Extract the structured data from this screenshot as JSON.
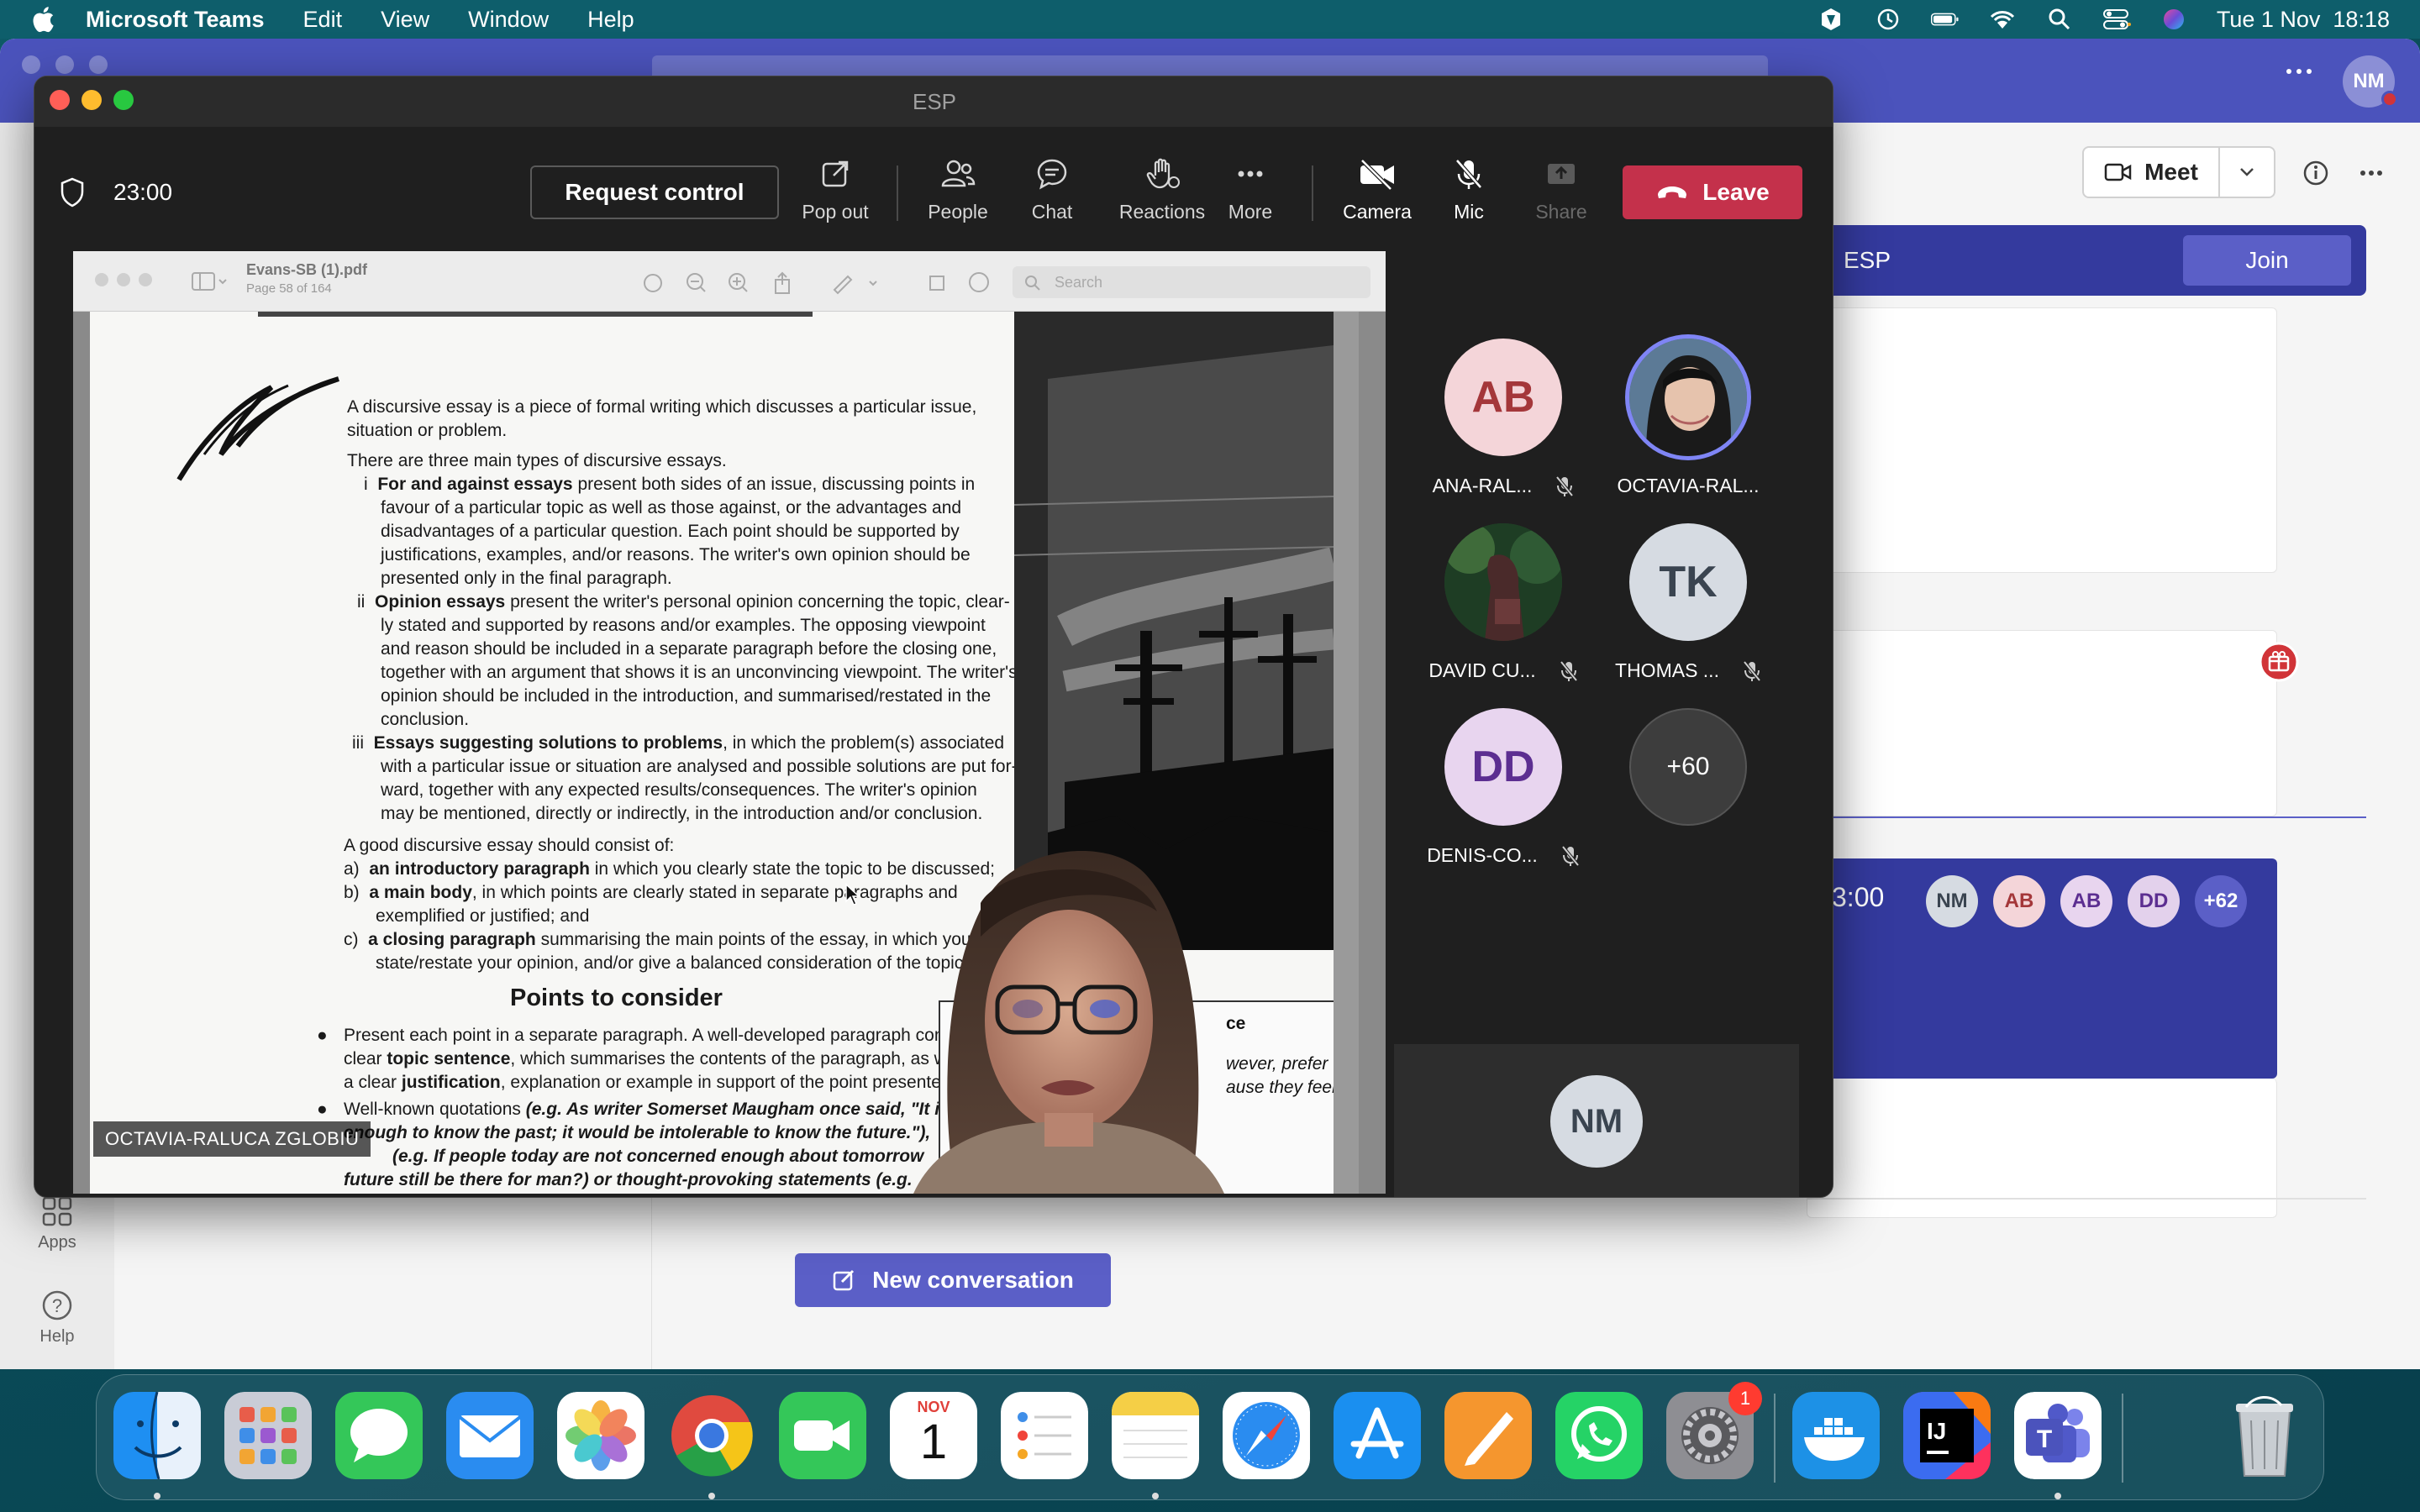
{
  "menubar": {
    "app_name": "Microsoft Teams",
    "menus": [
      "Edit",
      "View",
      "Window",
      "Help"
    ],
    "clock": "Tue 1 Nov  18:18"
  },
  "teams_background": {
    "rail": {
      "apps_label": "Apps",
      "help_label": "Help"
    },
    "header": {
      "avatar_initials": "NM",
      "meet_label": "Meet"
    },
    "channel_banner": {
      "title": "ESP",
      "join_label": "Join"
    },
    "meeting_card": {
      "time_fragment": "3:00",
      "avatars": [
        "NM",
        "AB",
        "AB",
        "DD",
        "+62"
      ]
    },
    "new_conversation_label": "New conversation"
  },
  "meeting_window": {
    "title": "ESP",
    "timer": "23:00",
    "request_control_label": "Request control",
    "toolbar": {
      "pop_out": "Pop out",
      "people": "People",
      "chat": "Chat",
      "reactions": "Reactions",
      "more": "More",
      "camera": "Camera",
      "mic": "Mic",
      "share": "Share",
      "leave": "Leave"
    },
    "shared_screen": {
      "pdf_filename": "Evans-SB (1).pdf",
      "pdf_page": "Page 58 of 164",
      "pdf_search_placeholder": "Search",
      "speaker_name": "OCTAVIA-RALUCA ZGLOBIU",
      "document_lines": {
        "l1": "A discursive essay is a piece of formal writing which discusses a particular issue,",
        "l2": "situation or problem.",
        "l3": "There are three main types of discursive essays.",
        "l4_num": "i",
        "l4_bold": "For and against essays",
        "l4_rest": " present both sides of an issue, discussing points in",
        "l5": "favour of a particular topic as well as those against, or the advantages and",
        "l6": "disadvantages of a particular question. Each point should be supported by",
        "l7": "justifications, examples, and/or reasons. The writer's own opinion should be",
        "l8": "presented only in the final paragraph.",
        "l9_num": "ii",
        "l9_bold": "Opinion essays",
        "l9_rest": " present the writer's personal opinion concerning the topic, clear-",
        "l10": "ly stated and supported by reasons and/or examples. The opposing viewpoint",
        "l11": "and reason should be included in a separate paragraph before the closing one,",
        "l12": "together with an argument that shows it is an unconvincing viewpoint. The writer's",
        "l13": "opinion should be included in the introduction, and summarised/restated in the",
        "l14": "conclusion.",
        "l15_num": "iii",
        "l15_bold": "Essays suggesting solutions to problems",
        "l15_rest": ", in which the problem(s) associated",
        "l16": "with a particular issue or situation are analysed and possible solutions are put for-",
        "l17": "ward, together with any expected results/consequences. The writer's opinion",
        "l18": "may be mentioned, directly or indirectly, in the introduction and/or conclusion.",
        "l19": "A good discursive essay should consist of:",
        "l20_num": "a)",
        "l20_bold": "an introductory paragraph",
        "l20_rest": " in which you clearly state the topic to be discussed;",
        "l21_num": "b)",
        "l21_bold": "a main body",
        "l21_rest": ", in which points are clearly stated in separate paragraphs and",
        "l22": "exemplified or justified; and",
        "l23_num": "c)",
        "l23_bold": "a closing paragraph",
        "l23_rest": " summarising the main points of the essay, in which you",
        "l24": "state/restate your opinion, and/or give a balanced consideration of the topic.",
        "heading": "Points to consider",
        "l25": "Present each point in a separate paragraph. A well-developed paragraph contains a",
        "l26_pre": "clear ",
        "l26_bold": "topic sentence",
        "l26_rest": ", which summarises the contents of the paragraph, as well as",
        "l27_pre": "a clear ",
        "l27_bold": "justification",
        "l27_rest": ", explanation or example in support of the point presented.",
        "l28_pre": "Well-known quotations ",
        "l28_it": "(e.g. As writer Somerset Maugham once said, \"It is b",
        "l29": "enough to know the past; it would be intolerable to know the future.\"),",
        "l30": "(e.g. If people today are not concerned enough about tomorrow",
        "l31": "future still be there for man?) or thought-provoking statements (e.g.",
        "box_frag1": "ce",
        "box_frag2": "wever, prefer",
        "box_frag3": "ause they feel"
      }
    },
    "participants": [
      {
        "initials": "AB",
        "name": "ANA-RAL...",
        "muted": true
      },
      {
        "initials": "",
        "name": "OCTAVIA-RAL...",
        "muted": false,
        "speaking": true
      },
      {
        "initials": "",
        "name": "DAVID CU...",
        "muted": true
      },
      {
        "initials": "TK",
        "name": "THOMAS ...",
        "muted": true
      },
      {
        "initials": "DD",
        "name": "DENIS-CO...",
        "muted": true
      },
      {
        "initials": "+60",
        "name": "",
        "muted": false
      }
    ],
    "self_view": {
      "initials": "NM"
    }
  },
  "dock": {
    "calendar_month": "NOV",
    "calendar_day": "1",
    "settings_badge": "1"
  },
  "colors": {
    "teams_purple": "#5b5fc7",
    "leave_red": "#c4314b",
    "desktop_teal": "#0c4a57"
  }
}
